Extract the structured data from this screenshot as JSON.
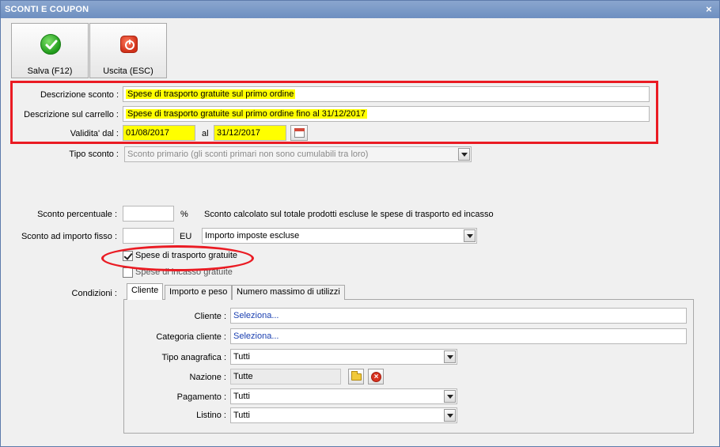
{
  "window": {
    "title": "SCONTI E COUPON",
    "close_glyph": "×"
  },
  "toolbar": {
    "save_label": "Salva (F12)",
    "exit_label": "Uscita (ESC)"
  },
  "form": {
    "descrizione_label": "Descrizione sconto :",
    "descrizione_value": "Spese di trasporto gratuite sul primo ordine",
    "carrello_label": "Descrizione sul carrello :",
    "carrello_value": "Spese di trasporto gratuite sul primo ordine fino al 31/12/2017",
    "validita_label": "Validita' dal :",
    "validita_dal": "01/08/2017",
    "al_label": "al",
    "validita_al": "31/12/2017",
    "tipo_label": "Tipo sconto :",
    "tipo_value": "Sconto primario (gli sconti primari non sono cumulabili tra loro)",
    "percentuale_label": "Sconto percentuale :",
    "percentuale_value": "",
    "percent_unit": "%",
    "percentuale_note": "Sconto calcolato sul totale prodotti escluse le spese di trasporto ed incasso",
    "importo_label": "Sconto ad importo fisso :",
    "importo_value": "",
    "importo_unit": "EU",
    "importo_mode": "Importo imposte escluse",
    "spese_trasporto_label": "Spese di trasporto gratuite",
    "spese_incasso_label": "Spese di incasso gratuite",
    "condizioni_label": "Condizioni :"
  },
  "tabs": [
    {
      "label": "Cliente"
    },
    {
      "label": "Importo e peso"
    },
    {
      "label": "Numero massimo di utilizzi"
    }
  ],
  "cliente_tab": {
    "cliente_label": "Cliente :",
    "cliente_value": "Seleziona...",
    "categoria_label": "Categoria cliente :",
    "categoria_value": "Seleziona...",
    "tipo_anagrafica_label": "Tipo anagrafica :",
    "tipo_anagrafica_value": "Tutti",
    "nazione_label": "Nazione :",
    "nazione_value": "Tutte",
    "pagamento_label": "Pagamento :",
    "pagamento_value": "Tutti",
    "listino_label": "Listino :",
    "listino_value": "Tutti"
  },
  "colors": {
    "highlight": "#ffff00",
    "annotation": "#ea1b23",
    "link": "#1a3fb0"
  },
  "icons": [
    "check-icon",
    "power-icon",
    "calendar-icon",
    "folder-icon",
    "delete-icon",
    "chevron-down-icon",
    "close-icon"
  ]
}
